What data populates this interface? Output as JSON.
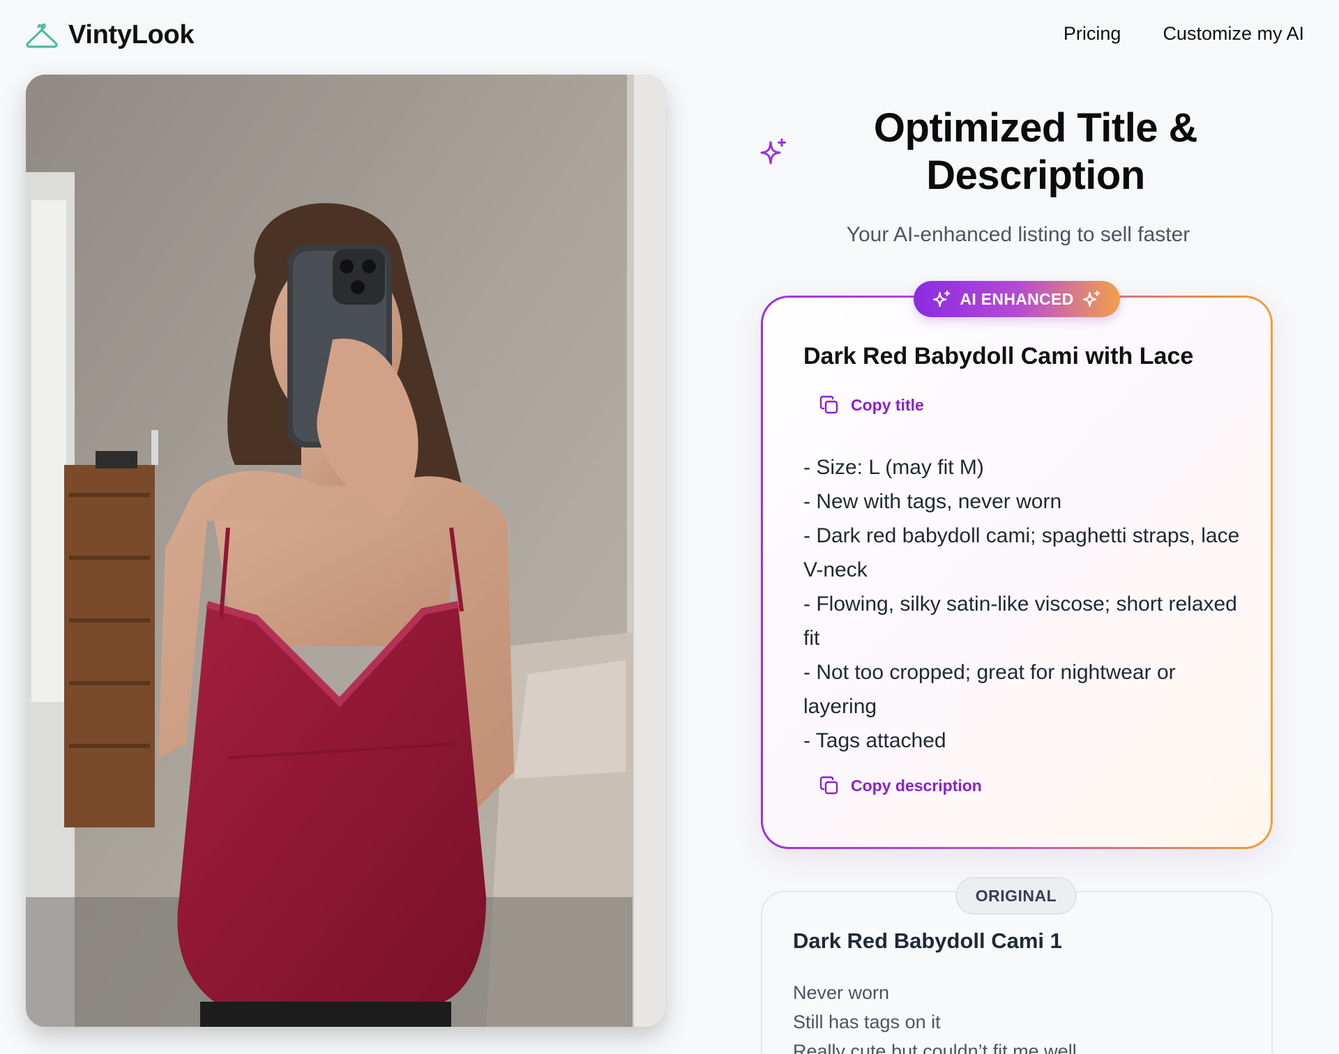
{
  "header": {
    "brand_name": "VintyLook",
    "nav": [
      {
        "label": "Pricing"
      },
      {
        "label": "Customize my AI"
      }
    ]
  },
  "panel": {
    "title": "Optimized Title & Description",
    "subtitle": "Your AI-enhanced listing to sell faster"
  },
  "ai_card": {
    "badge": "AI ENHANCED",
    "title": "Dark Red Babydoll Cami with Lace",
    "copy_title_label": "Copy title",
    "description_lines": [
      "- Size: L (may fit M)",
      "- New with tags, never worn",
      "- Dark red babydoll cami; spaghetti straps, lace V-neck",
      "- Flowing, silky satin-like viscose; short relaxed fit",
      "- Not too cropped; great for nightwear or layering",
      "- Tags attached"
    ],
    "copy_description_label": "Copy description"
  },
  "original_card": {
    "badge": "ORIGINAL",
    "title": "Dark Red Babydoll Cami 1",
    "description_lines": [
      "Never worn",
      "Still has tags on it",
      "Really cute but couldn’t fit me well"
    ]
  },
  "colors": {
    "brand_teal": "#4fb9a8",
    "accent_purple": "#8a1fd4",
    "accent_orange": "#f2a04b"
  },
  "icons": {
    "brand": "hanger-icon",
    "title": "sparkles-icon",
    "copy": "copy-icon"
  }
}
